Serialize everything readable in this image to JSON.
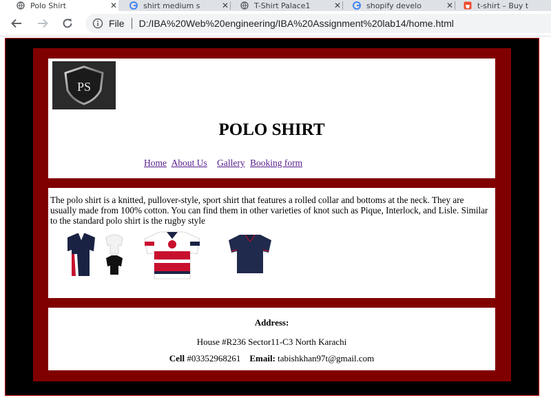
{
  "browser": {
    "tabs": [
      {
        "title": "Polo Shirt",
        "icon": "globe-icon",
        "active": true
      },
      {
        "title": "shirt medium s",
        "icon": "google-icon",
        "active": false
      },
      {
        "title": "T-Shirt Palace1",
        "icon": "globe-icon",
        "active": false
      },
      {
        "title": "shopify develo",
        "icon": "google-icon",
        "active": false
      },
      {
        "title": "t-shirt – Buy t",
        "icon": "store-icon",
        "active": false
      }
    ],
    "close_glyph": "✕",
    "omnibox": {
      "scheme_label": "File",
      "url": "D:/IBA%20Web%20engineering/IBA%20Assignment%20lab14/home.html"
    }
  },
  "page": {
    "logo_text": "PS",
    "title": "POLO SHIRT",
    "nav": [
      "Home",
      "About Us",
      "Gallery",
      "Booking form"
    ],
    "description": "The polo shirt is a knitted, pullover-style, sport shirt that features a rolled collar and bottoms at the neck. They are usually made from 100% cotton. You can find them in other varieties of knot such as Pique, Interlock, and Lisle. Similar to the standard polo shirt is the rugby style",
    "images": [
      "polo-shirts-navy-white-black",
      "polo-shirt-red-white-stripes",
      "polo-shirt-navy"
    ],
    "footer": {
      "address_label": "Address:",
      "address": "House #R236 Sector11-C3 North Karachi",
      "cell_label": "Cell",
      "cell": "#03352968261",
      "email_label": "Email:",
      "email": "tabishkhan97t@gmail.com"
    }
  },
  "colors": {
    "outer_bg": "#000000",
    "frame": "#800000",
    "link": "#551a8b",
    "tabbar": "#dee1e6"
  }
}
